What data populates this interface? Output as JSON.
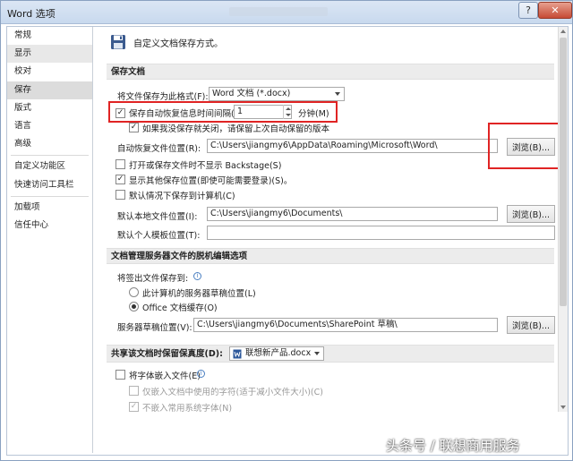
{
  "window": {
    "title": "Word 选项",
    "help_glyph": "?",
    "close_glyph": "✕"
  },
  "nav": {
    "items": [
      {
        "label": "常规"
      },
      {
        "label": "显示"
      },
      {
        "label": "校对"
      },
      {
        "label": "保存"
      },
      {
        "label": "版式"
      },
      {
        "label": "语言"
      },
      {
        "label": "高级"
      },
      {
        "label": "自定义功能区"
      },
      {
        "label": "快速访问工具栏"
      },
      {
        "label": "加载项"
      },
      {
        "label": "信任中心"
      }
    ],
    "selected": "保存"
  },
  "header": {
    "text": "自定义文档保存方式。"
  },
  "save_docs": {
    "section_title": "保存文档",
    "format_label": "将文件保存为此格式(F):",
    "format_value": "Word 文档 (*.docx)",
    "autosave_label": "保存自动恢复信息时间间隔(A)",
    "autosave_value": "1",
    "autosave_unit": "分钟(M)",
    "keep_last_label": "如果我没保存就关闭，请保留上次自动保留的版本",
    "recover_location_label": "自动恢复文件位置(R):",
    "recover_location_value": "C:\\Users\\jiangmy6\\AppData\\Roaming\\Microsoft\\Word\\",
    "browse_label": "浏览(B)...",
    "no_backstage_label": "打开或保存文件时不显示 Backstage(S)",
    "show_other_label": "显示其他保存位置(即使可能需要登录)(S)。",
    "default_computer_label": "默认情况下保存到计算机(C)",
    "local_location_label": "默认本地文件位置(I):",
    "local_location_value": "C:\\Users\\jiangmy6\\Documents\\",
    "browse2_label": "浏览(B)...",
    "template_location_label": "默认个人模板位置(T):",
    "template_location_value": ""
  },
  "offline": {
    "section_title": "文档管理服务器文件的脱机编辑选项",
    "checkout_label": "将签出文件保存到:",
    "option_server": "此计算机的服务器草稿位置(L)",
    "option_office": "Office 文档缓存(O)",
    "drafts_label": "服务器草稿位置(V):",
    "drafts_value": "C:\\Users\\jiangmy6\\Documents\\SharePoint 草稿\\",
    "browse3_label": "浏览(B)..."
  },
  "fidelity": {
    "section_title": "共享该文档时保留保真度(D):",
    "doc_name": "联想新产品.docx",
    "embed_fonts_label": "将字体嵌入文件(E)",
    "embed_used_label": "仅嵌入文档中使用的字符(适于减小文件大小)(C)",
    "no_system_label": "不嵌入常用系统字体(N)"
  },
  "watermark": {
    "text": "头条号 / 联想商用服务"
  },
  "checked_glyph": "✓",
  "info_glyph": "i",
  "colors": {
    "highlight_red": "#e02424",
    "selected_nav": "#dcdcdc"
  },
  "icons": [
    "floppy-save-icon",
    "info-icon",
    "dropdown-arrow-icon",
    "document-icon",
    "spin-up-icon",
    "spin-down-icon"
  ]
}
